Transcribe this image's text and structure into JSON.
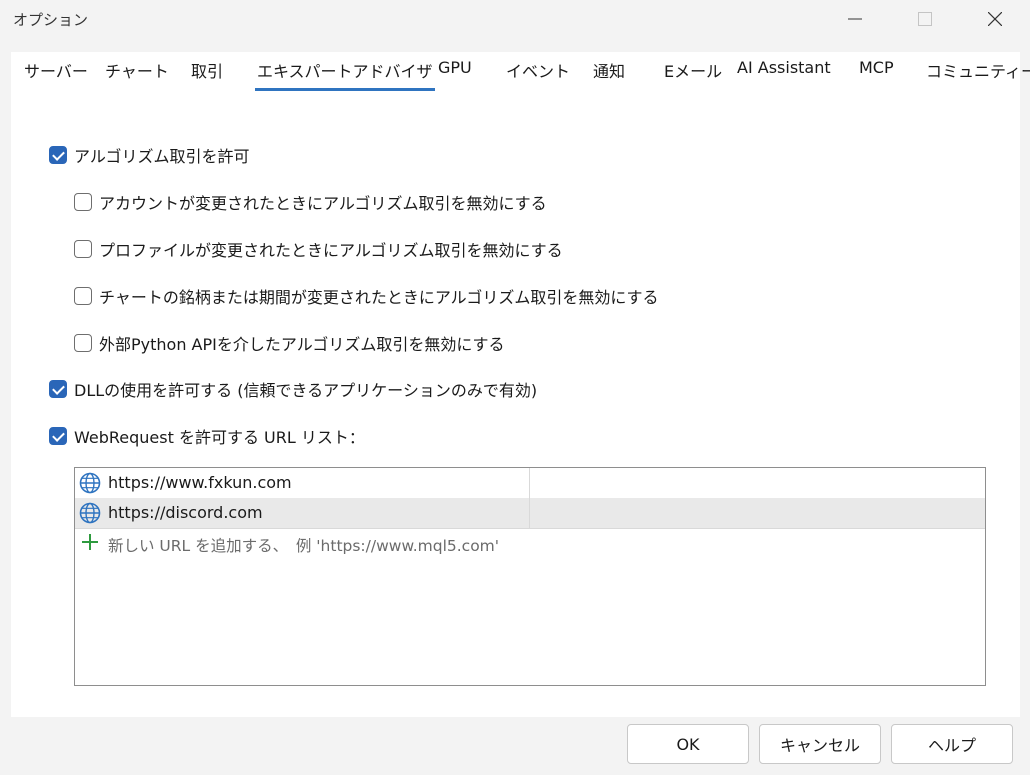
{
  "window": {
    "title": "オプション"
  },
  "tabs": [
    {
      "label": "サーバー"
    },
    {
      "label": "チャート"
    },
    {
      "label": "取引"
    },
    {
      "label": "エキスパートアドバイザ",
      "active": true
    },
    {
      "label": "GPU"
    },
    {
      "label": "イベント"
    },
    {
      "label": "通知"
    },
    {
      "label": "Eメール"
    },
    {
      "label": "AI Assistant"
    },
    {
      "label": "MCP"
    },
    {
      "label": "コミュニティー"
    }
  ],
  "options": [
    {
      "label": "アルゴリズム取引を許可",
      "checked": true
    },
    {
      "label": "アカウントが変更されたときにアルゴリズム取引を無効にする",
      "checked": false
    },
    {
      "label": "プロファイルが変更されたときにアルゴリズム取引を無効にする",
      "checked": false
    },
    {
      "label": "チャートの銘柄または期間が変更されたときにアルゴリズム取引を無効にする",
      "checked": false
    },
    {
      "label": "外部Python APIを介したアルゴリズム取引を無効にする",
      "checked": false
    },
    {
      "label": "DLLの使用を許可する (信頼できるアプリケーションのみで有効)",
      "checked": true
    },
    {
      "label": "WebRequest を許可する URL リスト：",
      "checked": true
    }
  ],
  "url_list": {
    "items": [
      {
        "url": "https://www.fxkun.com"
      },
      {
        "url": "https://discord.com",
        "selected": true
      }
    ],
    "add_hint": "新しい URL を追加する、　例 'https://www.mql5.com'"
  },
  "buttons": {
    "ok": "OK",
    "cancel": "キャンセル",
    "help": "ヘルプ"
  },
  "colors": {
    "accent": "#2a66b8",
    "tab_underline": "#2f74c0",
    "add_icon": "#2e9a3e",
    "globe_icon": "#2f74c0"
  },
  "icons": {
    "globe": "globe-icon",
    "add": "plus-icon"
  }
}
